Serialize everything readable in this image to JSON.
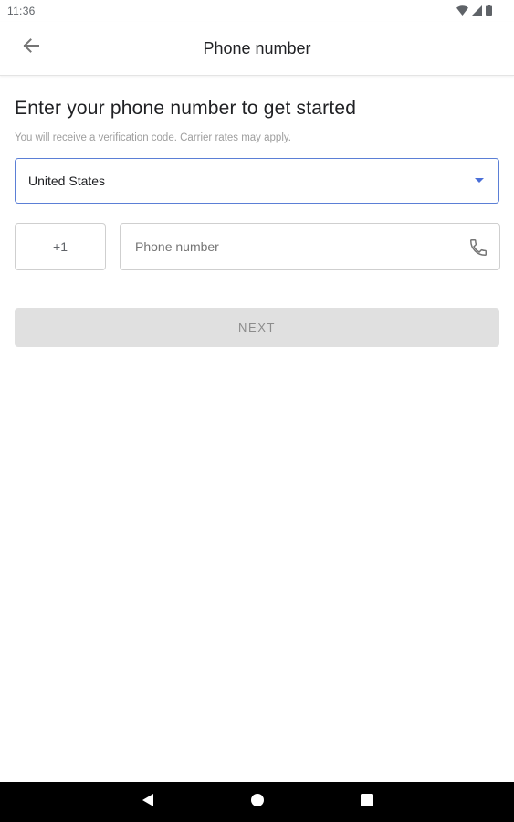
{
  "status_bar": {
    "time": "11:36",
    "icons": [
      "wifi-icon",
      "signal-icon",
      "battery-icon"
    ]
  },
  "app_bar": {
    "title": "Phone number",
    "back_icon": "arrow-back-icon"
  },
  "main": {
    "heading": "Enter your phone number to get started",
    "subtext": "You will receive a verification code. Carrier rates may apply.",
    "country_select": {
      "value": "United States",
      "icon": "dropdown-arrow-icon"
    },
    "country_code": "+1",
    "phone_input": {
      "value": "",
      "placeholder": "Phone number",
      "icon": "phone-icon"
    },
    "next_button": {
      "label": "NEXT",
      "enabled": false
    }
  },
  "nav_bar": {
    "icons": [
      "nav-back-icon",
      "nav-home-icon",
      "nav-recents-icon"
    ]
  },
  "colors": {
    "accent": "#4a6fd8",
    "focused_border": "#5b7fd6",
    "disabled_button": "#e0e0e0",
    "text_primary": "#202124",
    "text_secondary": "#9e9e9e"
  }
}
